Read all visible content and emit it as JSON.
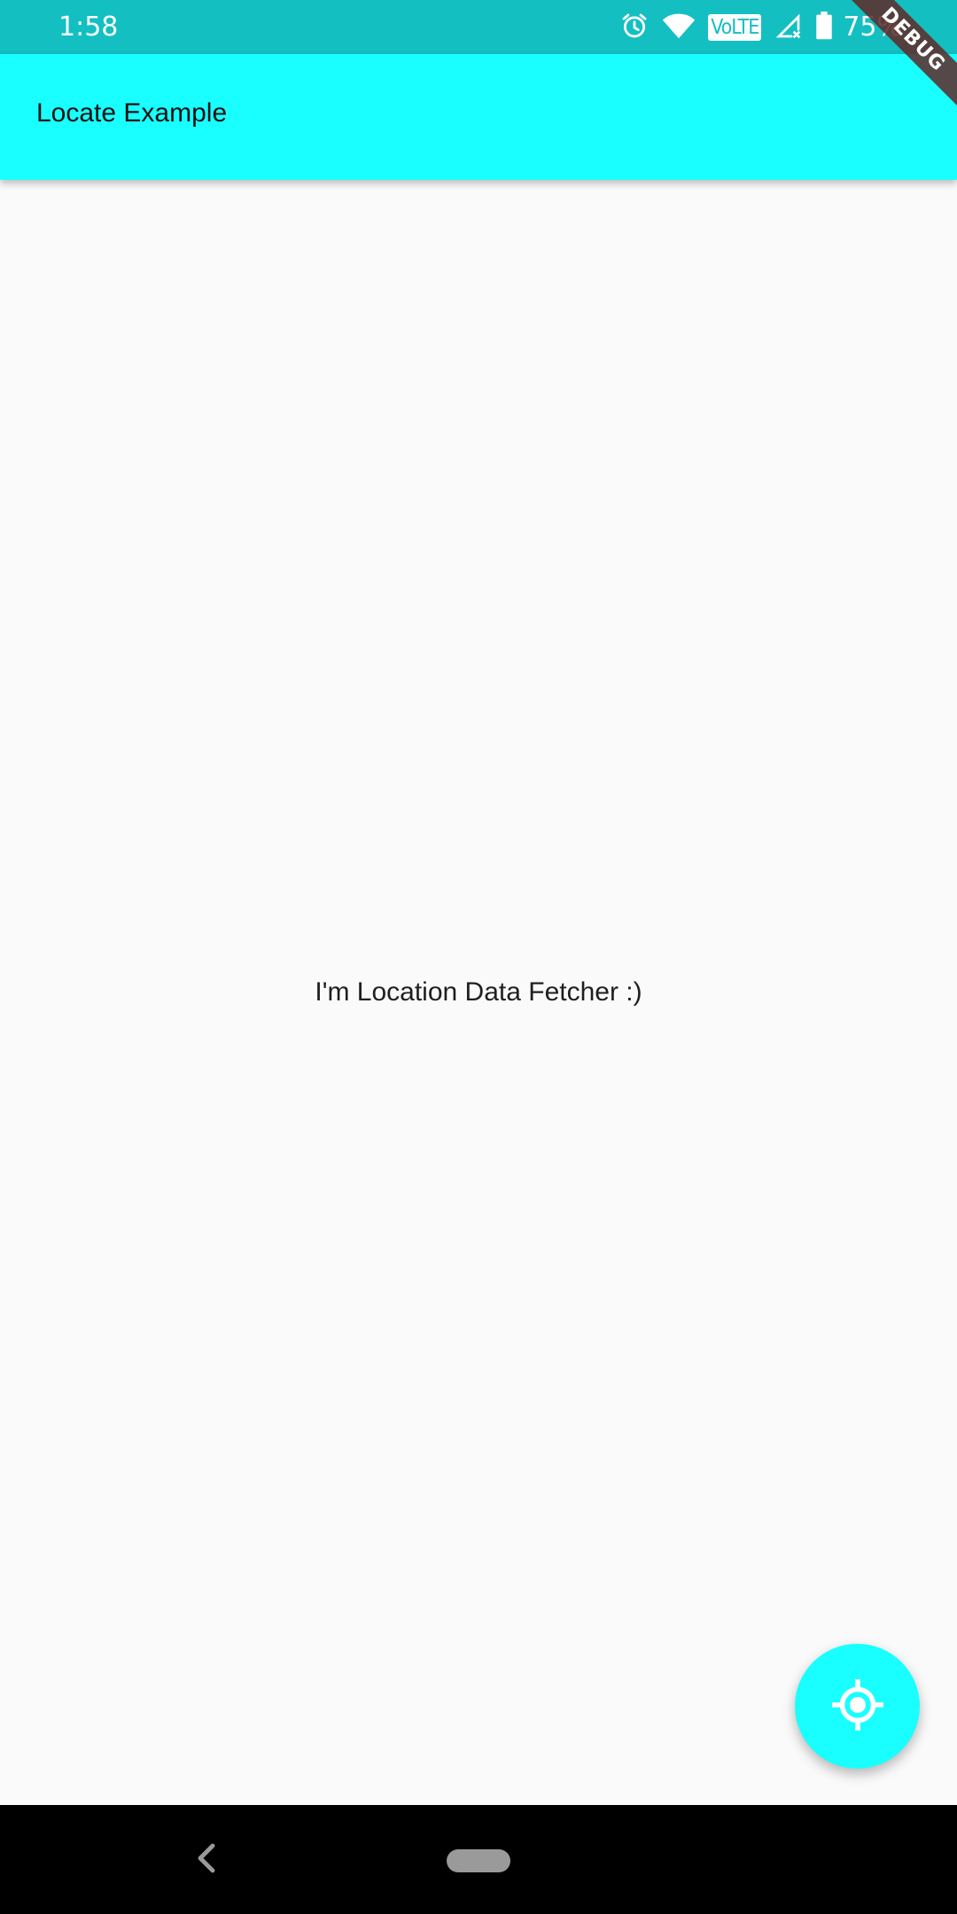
{
  "status_bar": {
    "time": "1:58",
    "volte": "VoLTE",
    "battery": "75%",
    "icons": [
      "alarm-icon",
      "wifi-icon",
      "volte-icon",
      "signal-icon",
      "battery-icon"
    ]
  },
  "app_bar": {
    "title": "Locate Example",
    "color": "#19ffff"
  },
  "debug_banner": {
    "label": "DEBUG"
  },
  "body": {
    "message": "I'm Location Data Fetcher :)"
  },
  "fab": {
    "icon": "my-location-icon",
    "color": "#19ffff"
  },
  "nav_bar": {
    "icons": [
      "back-icon",
      "home-pill"
    ]
  },
  "colors": {
    "status_bar": "#13bfc1",
    "app_bar": "#19ffff",
    "background": "#fafafa"
  }
}
